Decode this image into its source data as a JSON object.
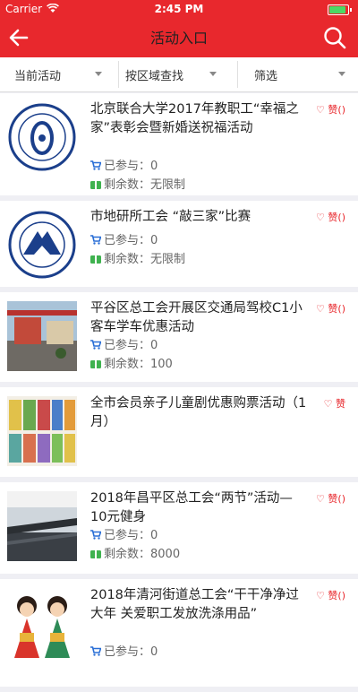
{
  "status": {
    "carrier": "Carrier",
    "time": "2:45 PM"
  },
  "nav": {
    "title": "活动入口"
  },
  "filters": [
    "当前活动",
    "按区域查找",
    "筛选"
  ],
  "like_label": "♡ 赞()",
  "like_label_short": "♡ 赞",
  "items": [
    {
      "title": "北京联合大学2017年教职工“幸福之家”表彰会暨新婚送祝福活动",
      "joined": "已参与：0",
      "remain": "剩余数：无限制"
    },
    {
      "title": "市地研所工会 “敲三家”比赛",
      "joined": "已参与：0",
      "remain": "剩余数：无限制"
    },
    {
      "title": "平谷区总工会开展区交通局驾校C1小客车学车优惠活动",
      "joined": "已参与：0",
      "remain": "剩余数：100"
    },
    {
      "title": "全市会员亲子儿童剧优惠购票活动（1月）"
    },
    {
      "title": "2018年昌平区总工会“两节”活动—10元健身",
      "joined": "已参与：0",
      "remain": "剩余数：8000"
    },
    {
      "title": "2018年清河街道总工会“干干净净过大年 关爱职工发放洗涤用品”",
      "joined": "已参与：0"
    }
  ]
}
